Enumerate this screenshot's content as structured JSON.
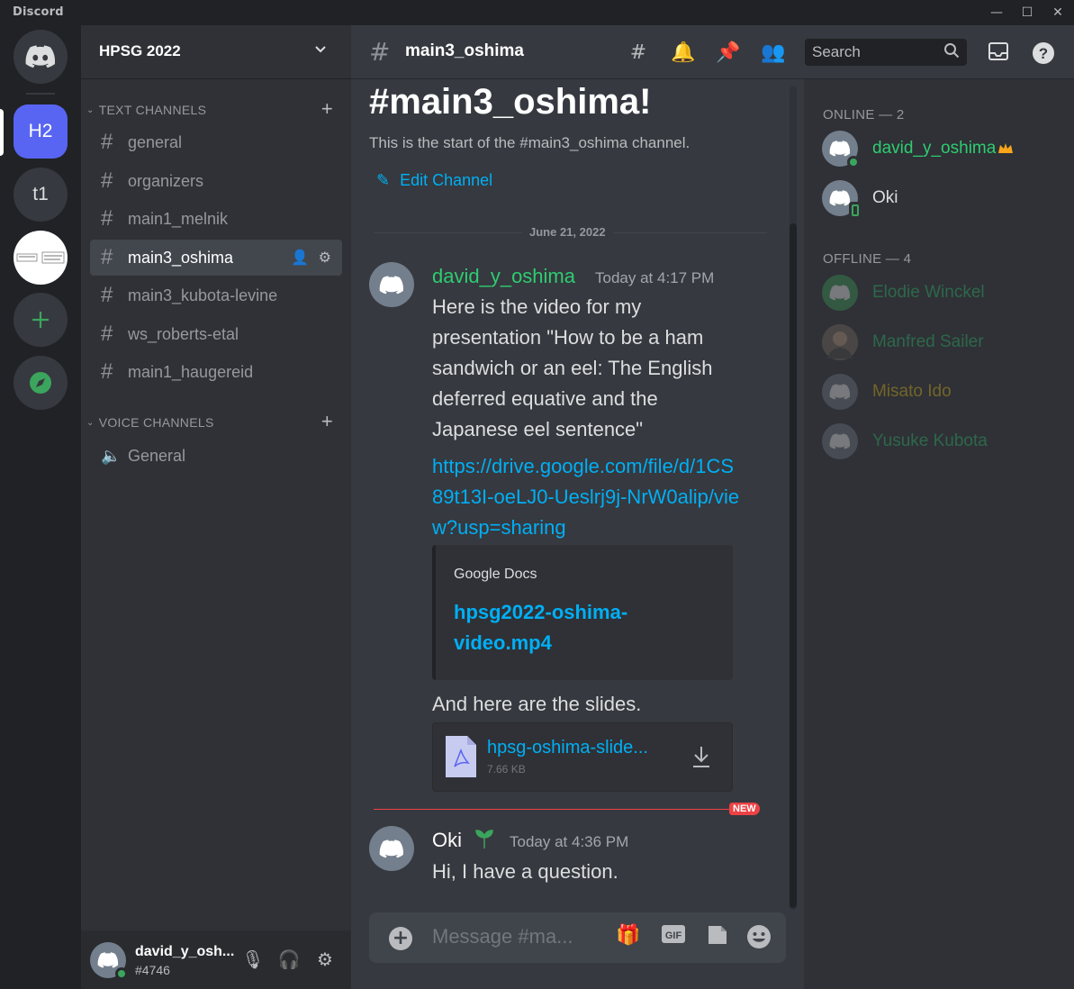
{
  "window": {
    "title": "Discord",
    "minimize": "—",
    "maximize": "☐",
    "close": "✕"
  },
  "guilds": [
    {
      "label": "H2"
    },
    {
      "label": "t1"
    }
  ],
  "server": {
    "name": "HPSG 2022"
  },
  "text_category": "TEXT CHANNELS",
  "voice_category": "VOICE CHANNELS",
  "text_channels": [
    {
      "name": "general"
    },
    {
      "name": "organizers"
    },
    {
      "name": "main1_melnik"
    },
    {
      "name": "main3_oshima"
    },
    {
      "name": "main3_kubota-levine"
    },
    {
      "name": "ws_roberts-etal"
    },
    {
      "name": "main1_haugereid"
    }
  ],
  "voice_channels": [
    {
      "name": "General"
    }
  ],
  "user": {
    "name": "david_y_osh...",
    "tag": "#4746"
  },
  "header": {
    "channel": "main3_oshima",
    "search_placeholder": "Search"
  },
  "welcome": {
    "title": "#main3_oshima!",
    "subtitle": "This is the start of the #main3_oshima channel.",
    "edit": "Edit Channel"
  },
  "date_divider": "June 21, 2022",
  "messages": [
    {
      "author": "david_y_oshima",
      "time": "Today at 4:17 PM",
      "text": "Here is the video for my presentation \"How to be a ham sandwich or an eel: The English deferred equative and the Japanese eel sentence\"",
      "link": "https://drive.google.com/file/d/1CS89t13I-oeLJ0-Ueslrj9j-NrW0alip/view?usp=sharing",
      "embed_provider": "Google Docs",
      "embed_title": "hpsg2022-oshima-video.mp4",
      "text2": "And here are the slides.",
      "attachment_name": "hpsg-oshima-slide...",
      "attachment_size": "7.66 KB"
    },
    {
      "author": "Oki",
      "time": "Today at 4:36 PM",
      "text": "Hi, I have a question."
    }
  ],
  "new_badge": "NEW",
  "composer_placeholder": "Message #ma...",
  "members": {
    "online_label": "ONLINE — 2",
    "offline_label": "OFFLINE — 4",
    "online": [
      {
        "name": "david_y_oshima"
      },
      {
        "name": "Oki"
      }
    ],
    "offline": [
      {
        "name": "Elodie Winckel"
      },
      {
        "name": "Manfred Sailer"
      },
      {
        "name": "Misato Ido"
      },
      {
        "name": "Yusuke Kubota"
      }
    ]
  },
  "colors": {
    "blurple": "#5865f2",
    "green_name": "#2ecc71",
    "link": "#00aff4",
    "offline_green": "#2ecc71",
    "gold": "#f1c40f"
  }
}
